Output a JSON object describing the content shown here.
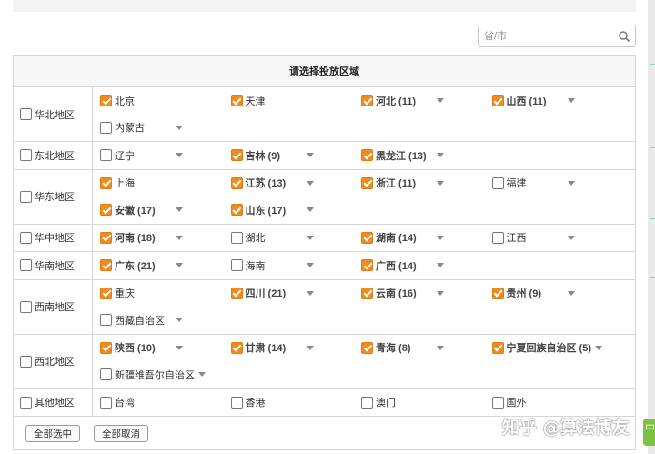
{
  "search": {
    "placeholder": "省/市"
  },
  "panel": {
    "title": "请选择投放区域"
  },
  "regions": [
    {
      "name": "华北地区",
      "provinces": [
        {
          "label": "北京",
          "checked": true,
          "dropdown": false
        },
        {
          "label": "天津",
          "checked": true,
          "dropdown": false
        },
        {
          "label": "河北 (11)",
          "checked": true,
          "dropdown": true
        },
        {
          "label": "山西 (11)",
          "checked": true,
          "dropdown": true
        },
        {
          "label": "内蒙古",
          "checked": false,
          "dropdown": true
        }
      ]
    },
    {
      "name": "东北地区",
      "provinces": [
        {
          "label": "辽宁",
          "checked": false,
          "dropdown": true
        },
        {
          "label": "吉林 (9)",
          "checked": true,
          "dropdown": true
        },
        {
          "label": "黑龙江 (13)",
          "checked": true,
          "dropdown": true
        }
      ]
    },
    {
      "name": "华东地区",
      "provinces": [
        {
          "label": "上海",
          "checked": true,
          "dropdown": false
        },
        {
          "label": "江苏 (13)",
          "checked": true,
          "dropdown": true
        },
        {
          "label": "浙江 (11)",
          "checked": true,
          "dropdown": true
        },
        {
          "label": "福建",
          "checked": false,
          "dropdown": true
        },
        {
          "label": "安徽 (17)",
          "checked": true,
          "dropdown": true
        },
        {
          "label": "山东 (17)",
          "checked": true,
          "dropdown": true
        }
      ]
    },
    {
      "name": "华中地区",
      "provinces": [
        {
          "label": "河南 (18)",
          "checked": true,
          "dropdown": true
        },
        {
          "label": "湖北",
          "checked": false,
          "dropdown": true
        },
        {
          "label": "湖南 (14)",
          "checked": true,
          "dropdown": true
        },
        {
          "label": "江西",
          "checked": false,
          "dropdown": true
        }
      ]
    },
    {
      "name": "华南地区",
      "provinces": [
        {
          "label": "广东 (21)",
          "checked": true,
          "dropdown": true
        },
        {
          "label": "海南",
          "checked": false,
          "dropdown": true
        },
        {
          "label": "广西 (14)",
          "checked": true,
          "dropdown": true
        }
      ]
    },
    {
      "name": "西南地区",
      "provinces": [
        {
          "label": "重庆",
          "checked": true,
          "dropdown": false
        },
        {
          "label": "四川 (21)",
          "checked": true,
          "dropdown": true
        },
        {
          "label": "云南 (16)",
          "checked": true,
          "dropdown": true
        },
        {
          "label": "贵州 (9)",
          "checked": true,
          "dropdown": true
        },
        {
          "label": "西藏自治区",
          "checked": false,
          "dropdown": true
        }
      ]
    },
    {
      "name": "西北地区",
      "provinces": [
        {
          "label": "陕西 (10)",
          "checked": true,
          "dropdown": true
        },
        {
          "label": "甘肃 (14)",
          "checked": true,
          "dropdown": true
        },
        {
          "label": "青海 (8)",
          "checked": true,
          "dropdown": true
        },
        {
          "label": "宁夏回族自治区 (5)",
          "checked": true,
          "dropdown": true,
          "caret_inline": true
        },
        {
          "label": "新疆维吾尔自治区",
          "checked": false,
          "dropdown": true,
          "caret_inline": true
        }
      ]
    },
    {
      "name": "其他地区",
      "provinces": [
        {
          "label": "台湾",
          "checked": false,
          "dropdown": false
        },
        {
          "label": "香港",
          "checked": false,
          "dropdown": false
        },
        {
          "label": "澳门",
          "checked": false,
          "dropdown": false
        },
        {
          "label": "国外",
          "checked": false,
          "dropdown": false
        }
      ]
    }
  ],
  "footer": {
    "select_all": "全部选中",
    "deselect_all": "全部取消"
  },
  "watermark": "知乎 @算法博友",
  "corner_tab": "中",
  "colors": {
    "checked": "#f08c1e",
    "border": "#d6d6d6",
    "header_bg": "#f5f5f5"
  },
  "icons": {
    "search": "magnifier-icon",
    "dropdown": "caret-down-icon"
  }
}
